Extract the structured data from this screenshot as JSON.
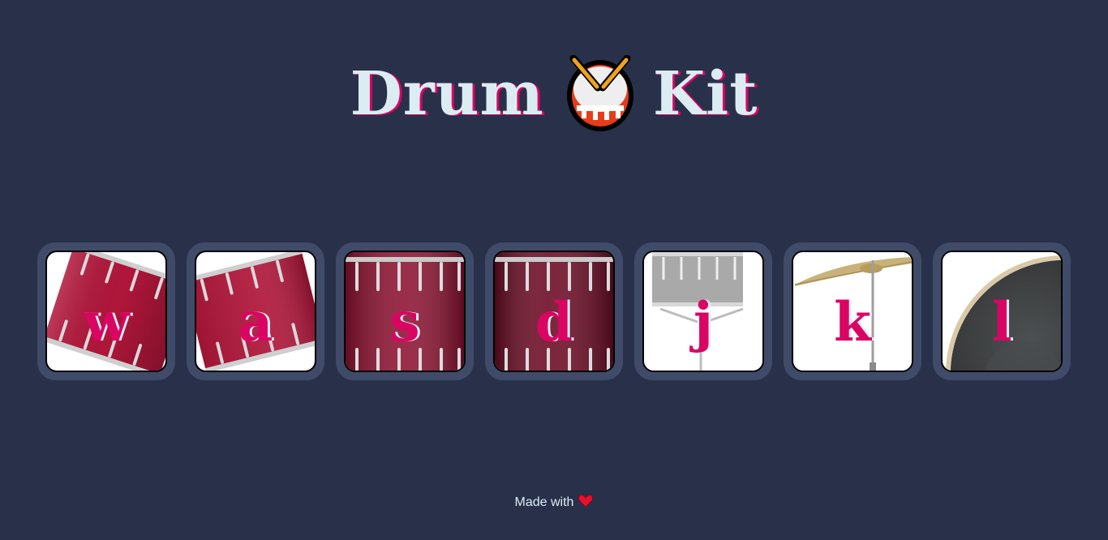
{
  "title": {
    "word_left": "Drum",
    "emoji_icon": "drum-emoji-icon",
    "word_right": "Kit"
  },
  "drums": [
    {
      "key": "w",
      "kind": "tom"
    },
    {
      "key": "a",
      "kind": "tom"
    },
    {
      "key": "s",
      "kind": "snare"
    },
    {
      "key": "d",
      "kind": "snare"
    },
    {
      "key": "j",
      "kind": "hi-hat"
    },
    {
      "key": "k",
      "kind": "crash"
    },
    {
      "key": "l",
      "kind": "kick"
    }
  ],
  "footer": {
    "text": "Made with",
    "icon": "heart-icon"
  },
  "colors": {
    "background": "#283149",
    "tile": "#404B69",
    "accent": "#DA0463",
    "text": "#DBEDF3"
  }
}
